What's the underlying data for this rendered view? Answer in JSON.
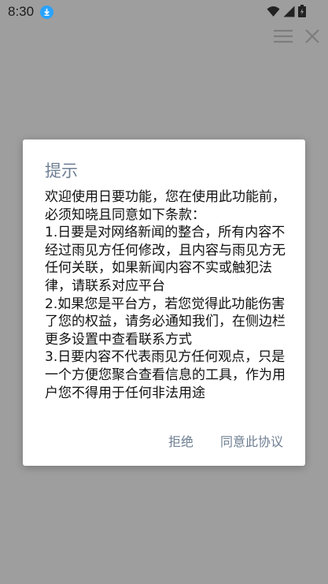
{
  "status_bar": {
    "time": "8:30",
    "download_icon": "download-icon",
    "wifi_icon": "wifi-icon",
    "signal_icon": "signal-icon",
    "battery_icon": "battery-icon"
  },
  "toolbar": {
    "menu_icon": "menu-icon",
    "close_icon": "close-icon"
  },
  "dialog": {
    "title": "提示",
    "body": "欢迎使用日要功能，您在使用此功能前，必须知晓且同意如下条款：\n1.日要是对网络新闻的整合，所有内容不经过雨见方任何修改，且内容与雨见方无任何关联，如果新闻内容不实或触犯法律，请联系对应平台\n2.如果您是平台方，若您觉得此功能伤害了您的权益，请务必通知我们，在侧边栏更多设置中查看联系方式\n3.日要内容不代表雨见方任何观点，只是一个方便您聚合查看信息的工具，作为用户您不得用于任何非法用途",
    "reject_label": "拒绝",
    "agree_label": "同意此协议"
  },
  "colors": {
    "overlay": "#9e9e9e",
    "accent": "#6f7f93",
    "download_badge": "#29a3ff"
  }
}
